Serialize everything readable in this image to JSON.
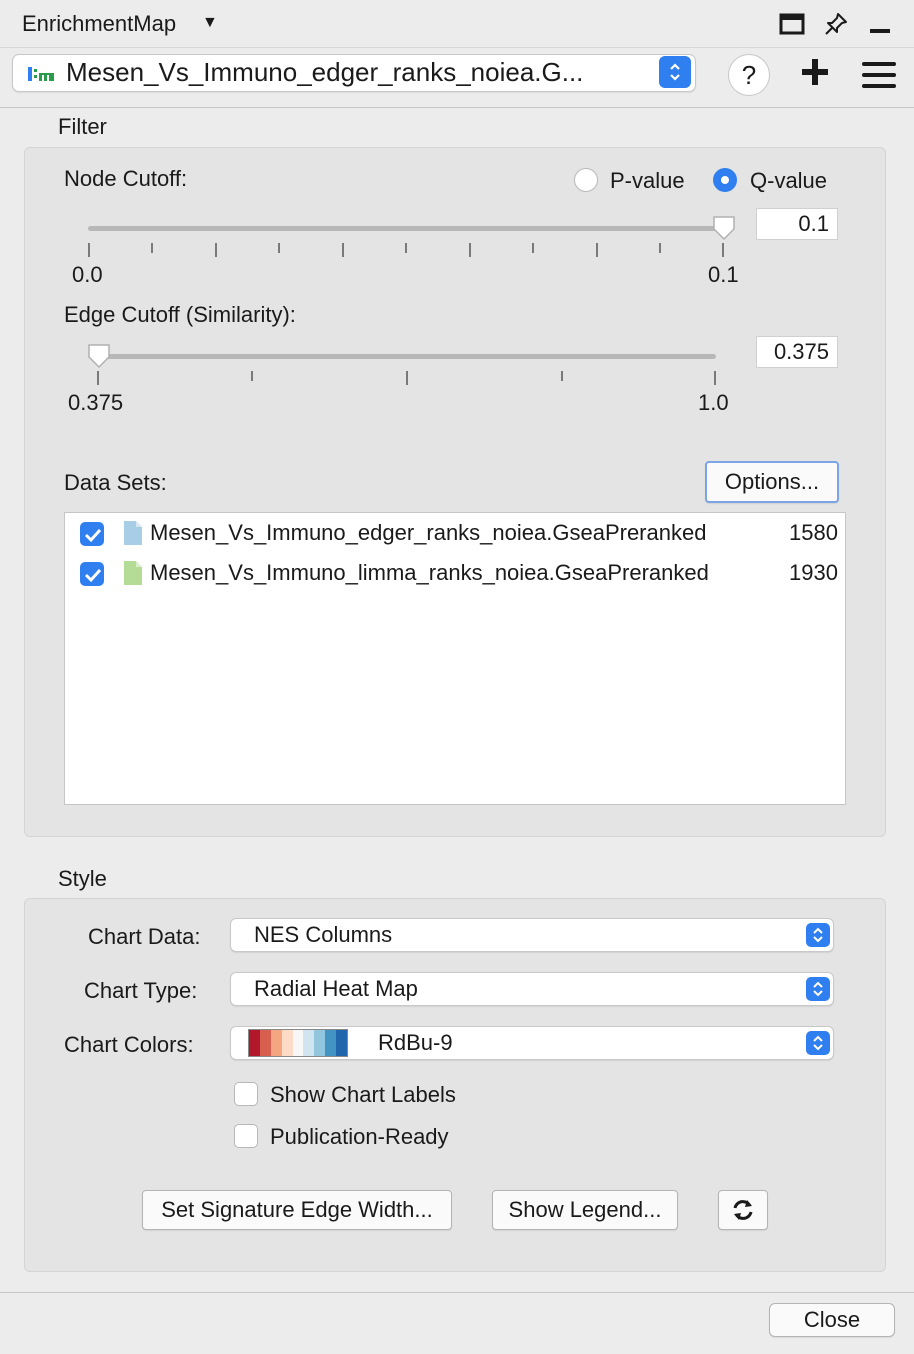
{
  "titlebar": {
    "title": "EnrichmentMap",
    "caret": "▼"
  },
  "network_selector": {
    "value": "Mesen_Vs_Immuno_edger_ranks_noiea.G..."
  },
  "help_label": "?",
  "filter": {
    "section_label": "Filter",
    "node_cutoff": {
      "label": "Node Cutoff:",
      "pvalue_label": "P-value",
      "qvalue_label": "Q-value",
      "selected": "Q-value",
      "min_label": "0.0",
      "max_label": "0.1",
      "value": "0.1"
    },
    "edge_cutoff": {
      "label": "Edge Cutoff (Similarity):",
      "min_label": "0.375",
      "max_label": "1.0",
      "value": "0.375"
    },
    "datasets": {
      "label": "Data Sets:",
      "options_label": "Options...",
      "items": [
        {
          "name": "Mesen_Vs_Immuno_edger_ranks_noiea.GseaPreranked",
          "count": "1580",
          "checked": true,
          "color": "#a8cde6"
        },
        {
          "name": "Mesen_Vs_Immuno_limma_ranks_noiea.GseaPreranked",
          "count": "1930",
          "checked": true,
          "color": "#b4dc96"
        }
      ]
    }
  },
  "style": {
    "section_label": "Style",
    "chart_data_label": "Chart Data:",
    "chart_data_value": "NES Columns",
    "chart_type_label": "Chart Type:",
    "chart_type_value": "Radial Heat Map",
    "chart_colors_label": "Chart Colors:",
    "chart_colors_value": "RdBu-9",
    "palette": [
      "#b2182b",
      "#d6604d",
      "#f4a582",
      "#fddbc7",
      "#f7f7f7",
      "#d1e5f0",
      "#92c5de",
      "#4393c3",
      "#2166ac"
    ],
    "show_chart_labels": "Show Chart Labels",
    "publication_ready": "Publication-Ready",
    "signature_button": "Set Signature Edge Width...",
    "legend_button": "Show Legend..."
  },
  "close_button": "Close"
}
